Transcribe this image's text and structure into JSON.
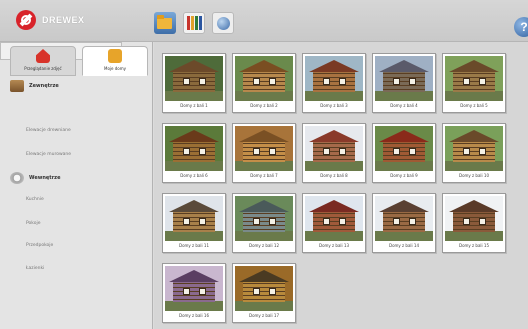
{
  "app": {
    "logo_text": "DREWEX",
    "help_label": "?"
  },
  "toolbar": {
    "icons": [
      "folder-icon",
      "books-icon",
      "globe-icon"
    ]
  },
  "sidebar": {
    "tabs": [
      {
        "label": "Przeglądanie zdjęć",
        "icon": "house-icon"
      },
      {
        "label": "Moje domy",
        "icon": "folder-icon"
      }
    ],
    "sections": [
      {
        "label": "Zewnętrze",
        "icon": "wood-icon",
        "items": [
          "Domy drewniane",
          "Elewacje drewniane",
          "Elewacje murowane"
        ]
      },
      {
        "label": "Wewnętrze",
        "icon": "disc-icon",
        "items": [
          "Kuchnie",
          "Pokoje",
          "Przedpokoje",
          "Łazienki"
        ]
      }
    ],
    "selected_item": "Domy drewniane"
  },
  "grid": {
    "items": [
      {
        "label": "Domy z bali 1",
        "colors": [
          "#8a6a3c",
          "#4e6b3a",
          "#6c4a2a"
        ]
      },
      {
        "label": "Domy z bali 2",
        "colors": [
          "#b7884c",
          "#6a8a4c",
          "#7a4e22"
        ]
      },
      {
        "label": "Domy z bali 3",
        "colors": [
          "#a87240",
          "#9fb7c6",
          "#7a3a24"
        ]
      },
      {
        "label": "Domy z bali 4",
        "colors": [
          "#7a6a56",
          "#9fb0c4",
          "#5a5a6a"
        ]
      },
      {
        "label": "Domy z bali 5",
        "colors": [
          "#9a7a48",
          "#7fa15a",
          "#6a4a2a"
        ]
      },
      {
        "label": "Domy z bali 6",
        "colors": [
          "#9b6f34",
          "#5b7a3a",
          "#6a3a1a"
        ]
      },
      {
        "label": "Domy z bali 7",
        "colors": [
          "#c48e48",
          "#a8743a",
          "#7a5024"
        ]
      },
      {
        "label": "Domy z bali 8",
        "colors": [
          "#a56a4a",
          "#e6e9ee",
          "#8a3a2a"
        ]
      },
      {
        "label": "Domy z bali 9",
        "colors": [
          "#a05a34",
          "#6a8a48",
          "#8a2a1a"
        ]
      },
      {
        "label": "Domy z bali 10",
        "colors": [
          "#b88a4a",
          "#7aa05a",
          "#6a4a2a"
        ]
      },
      {
        "label": "Domy z bali 11",
        "colors": [
          "#a8804a",
          "#dfe4ea",
          "#5a4a3a"
        ]
      },
      {
        "label": "Domy z bali 12",
        "colors": [
          "#7a8a8a",
          "#6a8a5a",
          "#4a5a5a"
        ]
      },
      {
        "label": "Domy z bali 13",
        "colors": [
          "#a05a3a",
          "#dfe6ee",
          "#7a2a22"
        ]
      },
      {
        "label": "Domy z bali 14",
        "colors": [
          "#9a6a44",
          "#e8ecf0",
          "#5a4032"
        ]
      },
      {
        "label": "Domy z bali 15",
        "colors": [
          "#8a5a3a",
          "#f0f2f4",
          "#5a3a28"
        ]
      },
      {
        "label": "Domy z bali 16",
        "colors": [
          "#8a6a8e",
          "#c9b7cf",
          "#5a3e62"
        ]
      },
      {
        "label": "Domy z bali 17",
        "colors": [
          "#b88a3c",
          "#9a6a28",
          "#4a3a22"
        ]
      }
    ]
  }
}
